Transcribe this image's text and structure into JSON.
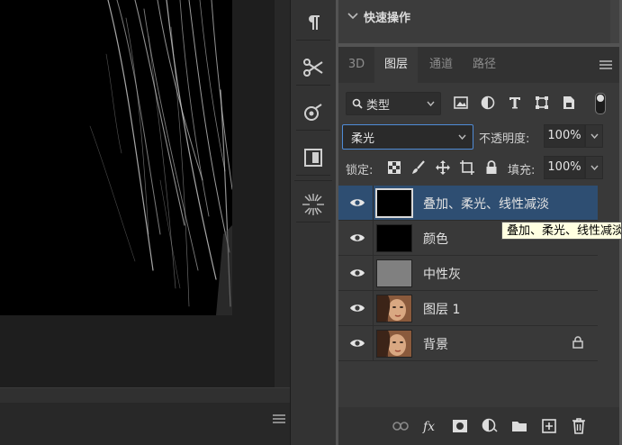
{
  "colors": {
    "selection": "#2e4e72",
    "accent_border": "#4f8bd6",
    "tooltip_bg": "#ffffe1"
  },
  "quick_ops": {
    "title": "快速操作"
  },
  "tabs": [
    {
      "label": "3D",
      "active": false
    },
    {
      "label": "图层",
      "active": true
    },
    {
      "label": "通道",
      "active": false
    },
    {
      "label": "路径",
      "active": false
    }
  ],
  "filter": {
    "kind_label": "类型"
  },
  "blend": {
    "mode": "柔光",
    "opacity_label": "不透明度:",
    "opacity": "100%"
  },
  "lock": {
    "label": "锁定:",
    "fill_label": "填充:",
    "fill": "100%"
  },
  "layers": [
    {
      "name": "叠加、柔光、线性减淡",
      "selected": true,
      "thumb": "black"
    },
    {
      "name": "颜色",
      "selected": false,
      "thumb": "black"
    },
    {
      "name": "中性灰",
      "selected": false,
      "thumb": "gray"
    },
    {
      "name": "图层 1",
      "selected": false,
      "thumb": "photo"
    },
    {
      "name": "背景",
      "selected": false,
      "thumb": "photo",
      "locked": true
    }
  ],
  "tooltip": "叠加、柔光、线性减淡",
  "tool_strip": [
    "paragraph-icon",
    "tool-presets-icon",
    "adjustments-icon",
    "navigator-icon",
    "brush-settings-icon"
  ],
  "footer_icons": [
    "link-layers-icon",
    "fx-icon",
    "add-mask-icon",
    "adjustment-layer-icon",
    "new-group-icon",
    "new-layer-icon",
    "delete-layer-icon"
  ]
}
